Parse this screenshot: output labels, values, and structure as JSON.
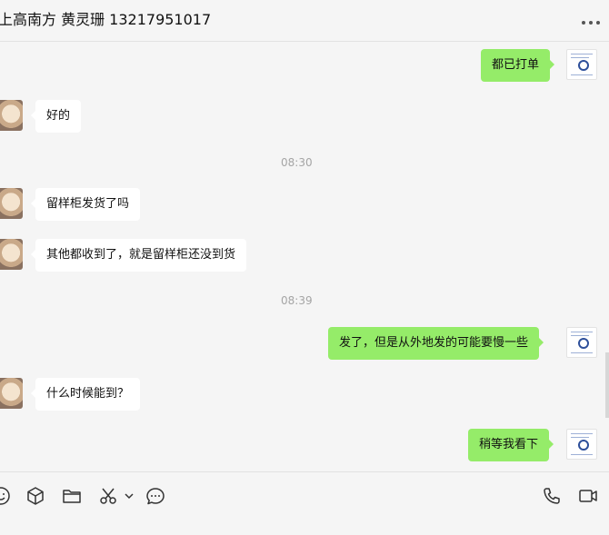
{
  "header": {
    "title": "上高南方 黄灵珊 13217951017",
    "more_icon": "more-horizontal-icon"
  },
  "messages": [
    {
      "type": "bubble",
      "side": "out",
      "text": "都已打单"
    },
    {
      "type": "bubble",
      "side": "in",
      "text": "好的"
    },
    {
      "type": "time",
      "text": "08:30"
    },
    {
      "type": "bubble",
      "side": "in",
      "text": "留样柜发货了吗"
    },
    {
      "type": "bubble",
      "side": "in",
      "text": "其他都收到了，就是留样柜还没到货"
    },
    {
      "type": "time",
      "text": "08:39"
    },
    {
      "type": "bubble",
      "side": "out",
      "text": "发了，但是从外地发的可能要慢一些"
    },
    {
      "type": "bubble",
      "side": "in",
      "text": "什么时候能到？"
    },
    {
      "type": "bubble",
      "side": "out",
      "text": "稍等我看下"
    }
  ],
  "toolbar": {
    "left_icons": [
      "emoji-icon",
      "favorites-cube-icon",
      "folder-icon",
      "screenshot-scissors-icon",
      "dropdown-chevron-icon",
      "chat-history-icon"
    ],
    "right_icons": [
      "voice-call-icon",
      "video-call-icon"
    ]
  },
  "colors": {
    "background": "#f5f5f5",
    "incoming_bubble": "#ffffff",
    "outgoing_bubble": "#95ec69",
    "timestamp": "#a5a5a5"
  }
}
